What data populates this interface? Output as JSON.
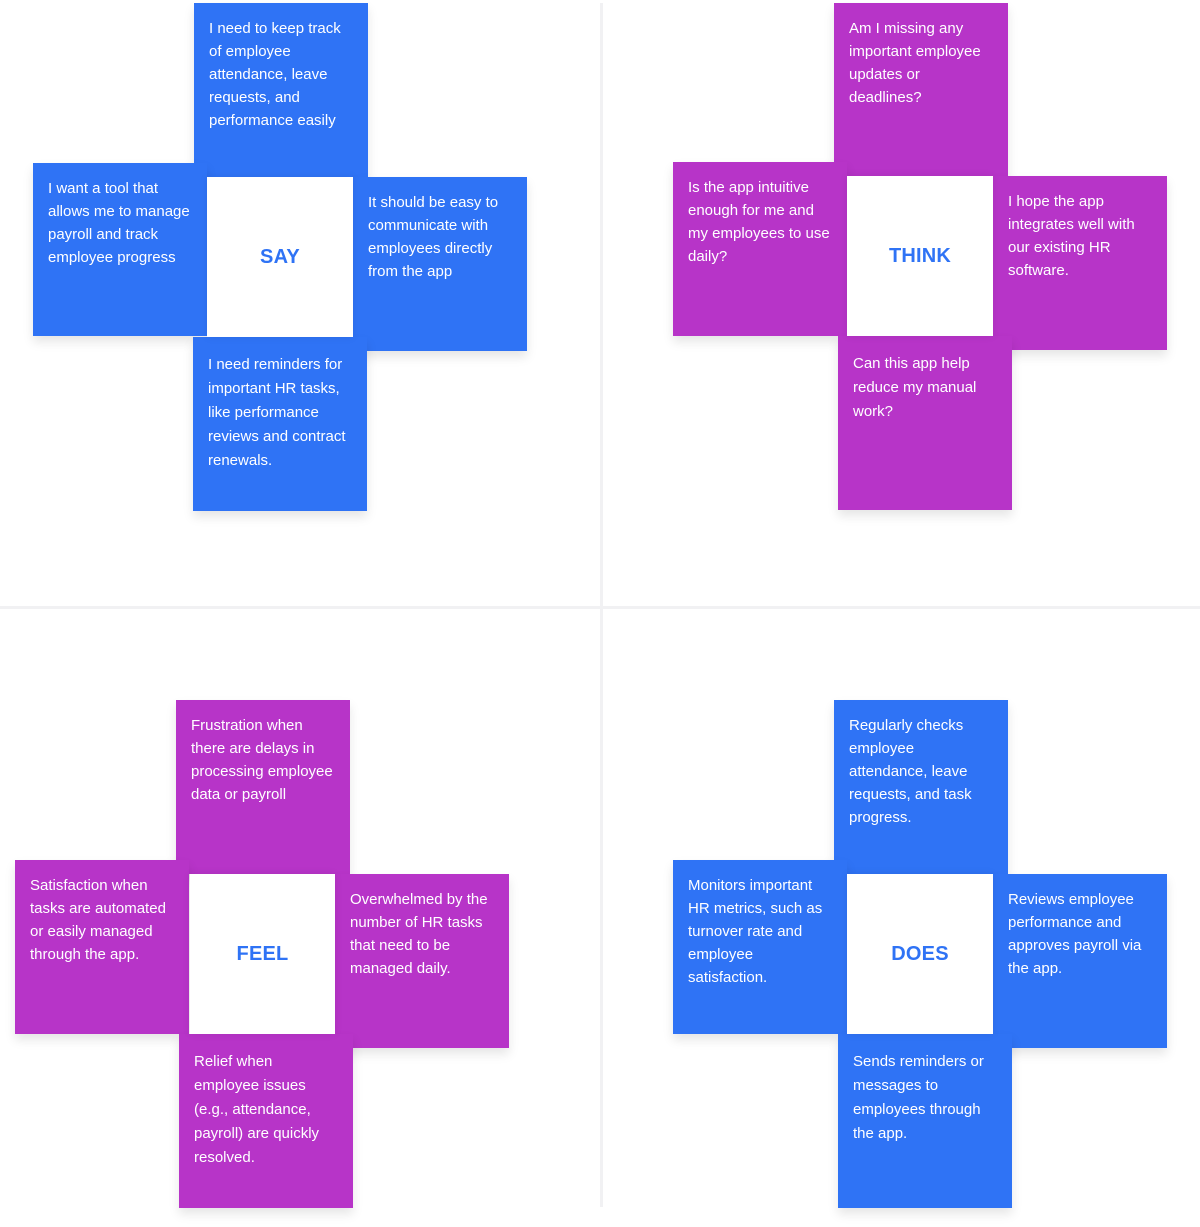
{
  "colors": {
    "say": "#2f73f5",
    "think": "#b734c8",
    "feel": "#b734c8",
    "does": "#2f73f5",
    "label": "#2f73f5"
  },
  "quadrants": {
    "say": {
      "label": "SAY",
      "top": "I need to keep track of employee attendance, leave requests, and performance easily",
      "left": "I want a tool that allows me to manage payroll and track employee progress",
      "right": "It should be easy to communicate with employees directly from the app",
      "bottom": "I need reminders for important HR tasks, like performance reviews and contract renewals."
    },
    "think": {
      "label": "THINK",
      "top": "Am I missing any important employee updates or deadlines?",
      "left": "Is the app intuitive enough for me and my employees to use daily?",
      "right": "I hope the app integrates well with our existing HR software.",
      "bottom": "Can this app help reduce my manual work?"
    },
    "feel": {
      "label": "FEEL",
      "top": "Frustration when there are delays in processing employee data or payroll",
      "left": "Satisfaction when tasks are automated or easily managed through the app.",
      "right": "Overwhelmed by the number of HR tasks that need to be managed daily.",
      "bottom": "Relief when employee issues (e.g., attendance, payroll) are quickly resolved."
    },
    "does": {
      "label": "DOES",
      "top": "Regularly checks employee attendance, leave requests, and task progress.",
      "left": "Monitors important HR metrics, such as turnover rate and employee satisfaction.",
      "right": "Reviews employee performance and approves payroll via the app.",
      "bottom": "Sends reminders or messages to employees through the app."
    }
  }
}
